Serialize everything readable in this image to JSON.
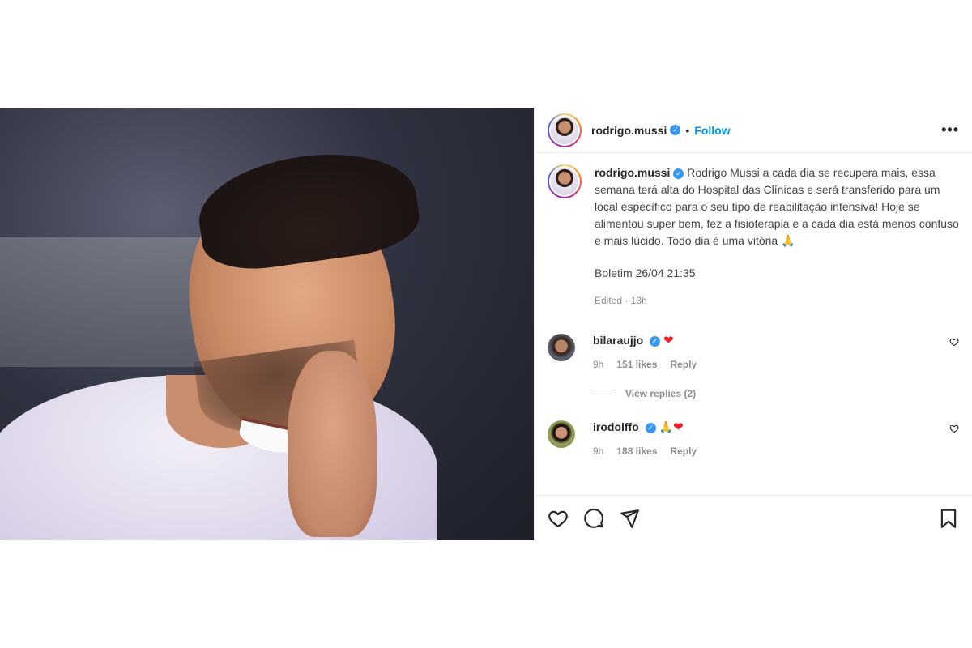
{
  "post": {
    "author": "rodrigo.mussi",
    "follow_label": "Follow",
    "dot": "•",
    "more_label": "•••"
  },
  "caption": {
    "username": "rodrigo.mussi",
    "text": "Rodrigo Mussi a cada dia se recupera mais, essa semana terá alta do Hospital das Clínicas e será transferido para um local específico para o seu tipo de reabilitação intensiva! Hoje se alimentou super bem, fez a fisioterapia e a cada dia está menos confuso e mais lúcido. Todo dia é uma vitória 🙏",
    "boletim": "Boletim 26/04 21:35",
    "edited": "Edited · 13h"
  },
  "comments": [
    {
      "username": "bilaraujjo",
      "text": "❤",
      "time": "9h",
      "likes": "151 likes",
      "reply_label": "Reply",
      "view_replies": "View replies (2)"
    },
    {
      "username": "irodolffo",
      "text_pray": "🙏",
      "text": "❤",
      "time": "9h",
      "likes": "188 likes",
      "reply_label": "Reply"
    }
  ],
  "colors": {
    "link": "#0095f6",
    "verified": "#3897f0",
    "heart": "#ed1c24",
    "muted": "#8e8e8e"
  },
  "icons": [
    "heart-icon",
    "comment-icon",
    "share-icon",
    "bookmark-icon",
    "more-icon",
    "verified-icon",
    "comment-like-icon"
  ]
}
